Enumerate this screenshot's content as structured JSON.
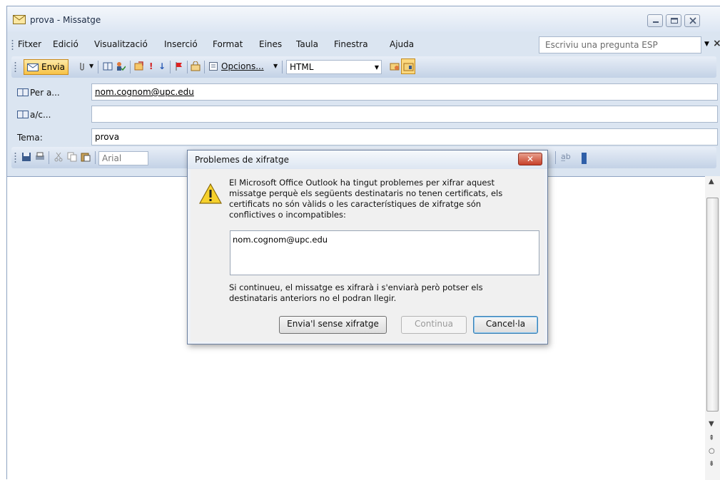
{
  "window": {
    "title": "prova - Missatge",
    "accent": "#dbe5f1"
  },
  "menu": {
    "items": [
      "Fitxer",
      "Edició",
      "Visualització",
      "Inserció",
      "Format",
      "Eines",
      "Taula",
      "Finestra",
      "Ajuda"
    ],
    "help_placeholder": "Escriviu una pregunta ESP"
  },
  "toolbar": {
    "send_label": "Envia",
    "options_label": "Opcions...",
    "format_value": "HTML"
  },
  "fields": {
    "to_label": "Per a...",
    "to_value": "nom.cognom@upc.edu",
    "cc_label": "a/c...",
    "cc_value": "",
    "subject_label": "Tema:",
    "subject_value": "prova"
  },
  "format_toolbar": {
    "font_value": "Arial"
  },
  "dialog": {
    "title": "Problemes de xifratge",
    "message": "El Microsoft Office Outlook ha tingut problemes per xifrar aquest missatge perquè els següents destinataris no tenen certificats, els certificats no són vàlids o les característiques de xifratge són conflictives o incompatibles:",
    "recipients": "nom.cognom@upc.edu",
    "note": "Si continueu, el missatge es xifrarà i s'enviarà però potser els destinataris anteriors no el podran llegir.",
    "btn_send_unencrypted": "Envia'l sense xifratge",
    "btn_continue": "Continua",
    "btn_cancel": "Cancel·la",
    "close_glyph": "✕"
  }
}
